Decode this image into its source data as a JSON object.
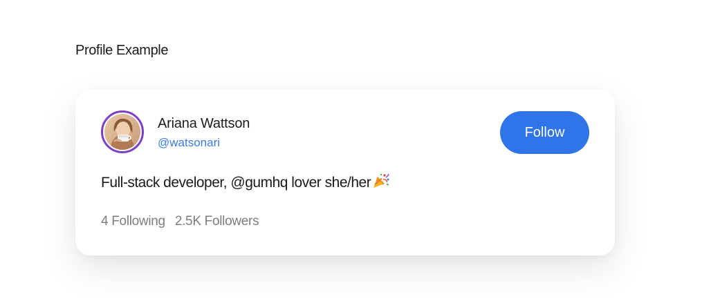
{
  "section": {
    "title": "Profile Example"
  },
  "profile": {
    "name": "Ariana Wattson",
    "handle": "@watsonari",
    "bio": "Full-stack developer, @gumhq lover she/her",
    "bio_emoji": "party-popper-icon",
    "following": "4 Following",
    "followers": "2.5K Followers"
  },
  "actions": {
    "follow_label": "Follow"
  },
  "colors": {
    "accent": "#2f74e8",
    "handle": "#3a7be0",
    "avatar_ring": "#7b3fc4",
    "muted_text": "#7d7d7d"
  }
}
